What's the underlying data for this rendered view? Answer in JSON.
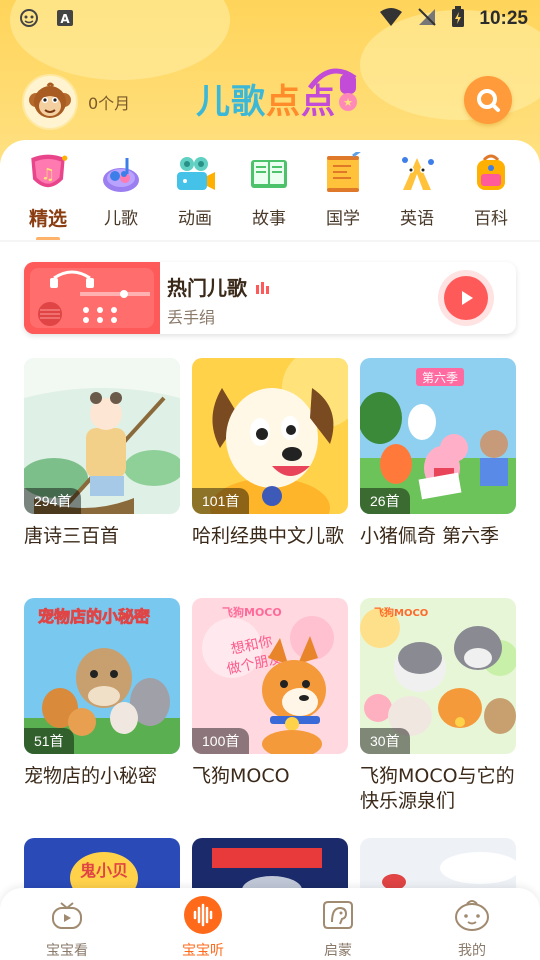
{
  "status_bar": {
    "time": "10:25"
  },
  "profile": {
    "age": "0个月"
  },
  "logo": {
    "text": [
      "儿",
      "歌",
      "点",
      "点"
    ]
  },
  "categories": [
    {
      "label": "精选",
      "icon": "featured-badge-icon",
      "active": true
    },
    {
      "label": "儿歌",
      "icon": "music-note-icon",
      "active": false
    },
    {
      "label": "动画",
      "icon": "camera-icon",
      "active": false
    },
    {
      "label": "故事",
      "icon": "book-icon",
      "active": false
    },
    {
      "label": "国学",
      "icon": "scroll-icon",
      "active": false
    },
    {
      "label": "英语",
      "icon": "abc-icon",
      "active": false
    },
    {
      "label": "百科",
      "icon": "backpack-icon",
      "active": false
    }
  ],
  "hot_card": {
    "title": "热门儿歌",
    "subtitle": "丢手绢"
  },
  "tiles": [
    {
      "title": "唐诗三百首",
      "count": "294首"
    },
    {
      "title": "哈利经典中文儿歌",
      "count": "101首"
    },
    {
      "title": "小猪佩奇 第六季",
      "count": "26首"
    },
    {
      "title": "宠物店的小秘密",
      "count": "51首"
    },
    {
      "title": "飞狗MOCO",
      "count": "100首"
    },
    {
      "title": "飞狗MOCO与它的快乐源泉们",
      "count": "30首"
    }
  ],
  "bottom_nav": [
    {
      "label": "宝宝看",
      "icon": "tv-icon",
      "active": false
    },
    {
      "label": "宝宝听",
      "icon": "sound-wave-icon",
      "active": true
    },
    {
      "label": "启蒙",
      "icon": "head-icon",
      "active": false
    },
    {
      "label": "我的",
      "icon": "baby-face-icon",
      "active": false
    }
  ],
  "colors": {
    "accent": "#ff6a1a",
    "brand_yellow": "#ffd45a",
    "hot_red": "#ff5a5a"
  }
}
